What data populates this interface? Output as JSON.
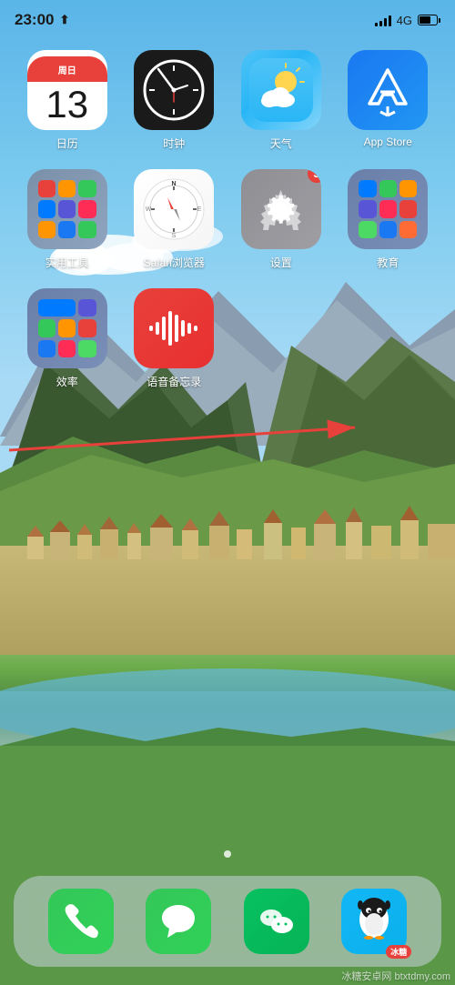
{
  "status_bar": {
    "time": "23:00",
    "location_icon": "◂",
    "signal_label": "4G",
    "battery_level": 65
  },
  "apps": [
    {
      "id": "calendar",
      "label": "日历",
      "weekday": "周日",
      "day": "13",
      "icon_type": "calendar"
    },
    {
      "id": "clock",
      "label": "时钟",
      "icon_type": "clock"
    },
    {
      "id": "weather",
      "label": "天气",
      "icon_type": "weather"
    },
    {
      "id": "appstore",
      "label": "App Store",
      "icon_type": "appstore"
    },
    {
      "id": "utilities",
      "label": "实用工具",
      "icon_type": "folder_utilities"
    },
    {
      "id": "safari",
      "label": "Safari浏览器",
      "icon_type": "safari"
    },
    {
      "id": "settings",
      "label": "设置",
      "icon_type": "settings",
      "badge": "3"
    },
    {
      "id": "education",
      "label": "教育",
      "icon_type": "folder_education"
    },
    {
      "id": "efficiency",
      "label": "效率",
      "icon_type": "folder_efficiency"
    },
    {
      "id": "voicememo",
      "label": "语音备忘录",
      "icon_type": "voicememo"
    }
  ],
  "dock": {
    "apps": [
      {
        "id": "phone",
        "label": "电话",
        "icon_type": "phone"
      },
      {
        "id": "messages",
        "label": "信息",
        "icon_type": "messages"
      },
      {
        "id": "wechat",
        "label": "微信",
        "icon_type": "wechat"
      },
      {
        "id": "qq",
        "label": "QQ",
        "icon_type": "qq"
      }
    ]
  },
  "watermark": "冰糖安卓网 btxtdmy.com",
  "page_dot": true
}
